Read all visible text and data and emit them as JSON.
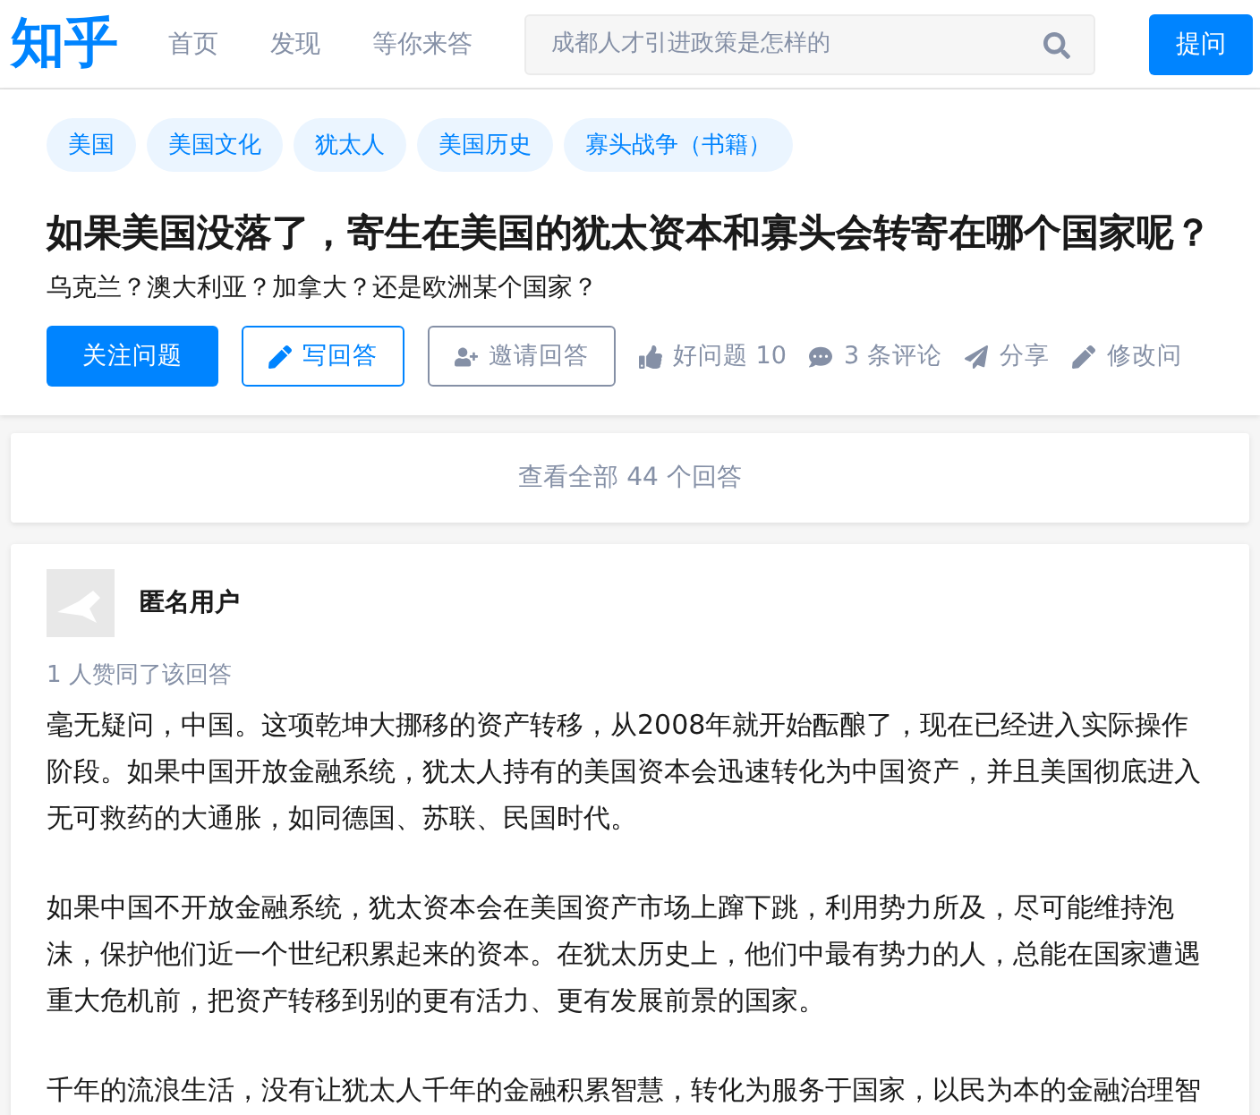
{
  "header": {
    "logo": "知乎",
    "nav": [
      {
        "label": "首页",
        "selected": false
      },
      {
        "label": "发现",
        "selected": false
      },
      {
        "label": "等你来答",
        "selected": false
      }
    ],
    "search": {
      "placeholder": "成都人才引进政策是怎样的"
    },
    "ask_button": "提问"
  },
  "question": {
    "topics": [
      "美国",
      "美国文化",
      "犹太人",
      "美国历史",
      "寡头战争（书籍）"
    ],
    "title": "如果美国没落了，寄生在美国的犹太资本和寡头会转寄在哪个国家呢？",
    "detail": "乌克兰？澳大利亚？加拿大？还是欧洲某个国家？",
    "actions": [
      {
        "kind": "primary",
        "label": "关注问题"
      },
      {
        "kind": "outline",
        "label": "写回答"
      },
      {
        "kind": "grey",
        "label": "邀请回答"
      },
      {
        "kind": "text",
        "label": "好问题 10"
      },
      {
        "kind": "text",
        "label": "3 条评论"
      },
      {
        "kind": "text",
        "label": "分享"
      },
      {
        "kind": "text",
        "label": "修改问"
      }
    ]
  },
  "view_all": "查看全部 44 个回答",
  "answer": {
    "author": "匿名用户",
    "votes": "1 人赞同了该回答",
    "paragraphs": [
      "毫无疑问，中国。这项乾坤大挪移的资产转移，从2008年就开始酝酿了，现在已经进入实际操作阶段。如果中国开放金融系统，犹太人持有的美国资本会迅速转化为中国资产，并且美国彻底进入无可救药的大通胀，如同德国、苏联、民国时代。",
      "如果中国不开放金融系统，犹太资本会在美国资产市场上蹿下跳，利用势力所及，尽可能维持泡沫，保护他们近一个世纪积累起来的资本。在犹太历史上，他们中最有势力的人，总能在国家遭遇重大危机前，把资产转移到别的更有活力、更有发展前景的国家。",
      "千年的流浪生活，没有让犹太人千年的金融积累智慧，转化为服务于国家，以民为本的金融治理智"
    ]
  }
}
